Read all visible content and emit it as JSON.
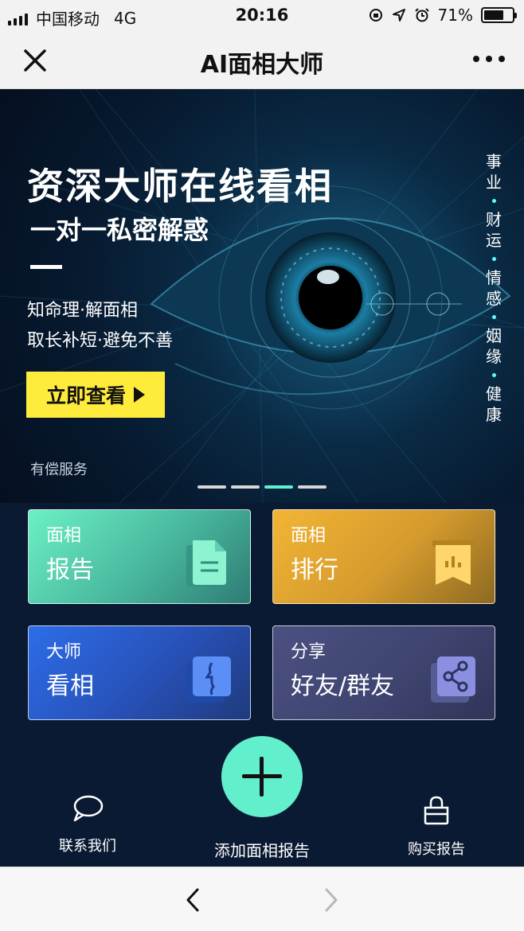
{
  "status_bar": {
    "carrier": "中国移动",
    "network": "4G",
    "time": "20:16",
    "battery_percent": "71%",
    "battery_level": 0.71
  },
  "nav": {
    "title": "AI面相大师",
    "close_icon": "close-icon",
    "more_icon": "more-dots-icon"
  },
  "banner": {
    "headline": "资深大师在线看相",
    "subheadline": "一对一私密解惑",
    "line1": "知命理·解面相",
    "line2": "取长补短·避免不善",
    "cta_label": "立即查看",
    "paid_note": "有偿服务",
    "side_words": [
      "事业",
      "财运",
      "情感",
      "姻缘",
      "健康"
    ],
    "carousel_active_index": 2,
    "carousel_count": 4
  },
  "cards": [
    {
      "top": "面相",
      "main": "报告",
      "icon": "document-icon",
      "color": "#48b79d"
    },
    {
      "top": "面相",
      "main": "排行",
      "icon": "ranking-chart-icon",
      "color": "#d49a2d"
    },
    {
      "top": "大师",
      "main": "看相",
      "icon": "face-profile-icon",
      "color": "#2851b8"
    },
    {
      "top": "分享",
      "main": "好友/群友",
      "icon": "share-icon",
      "color": "#3f4570"
    }
  ],
  "actions": {
    "contact_label": "联系我们",
    "add_label": "添加面相报告",
    "buy_label": "购买报告",
    "accent": "#62f0cc"
  }
}
